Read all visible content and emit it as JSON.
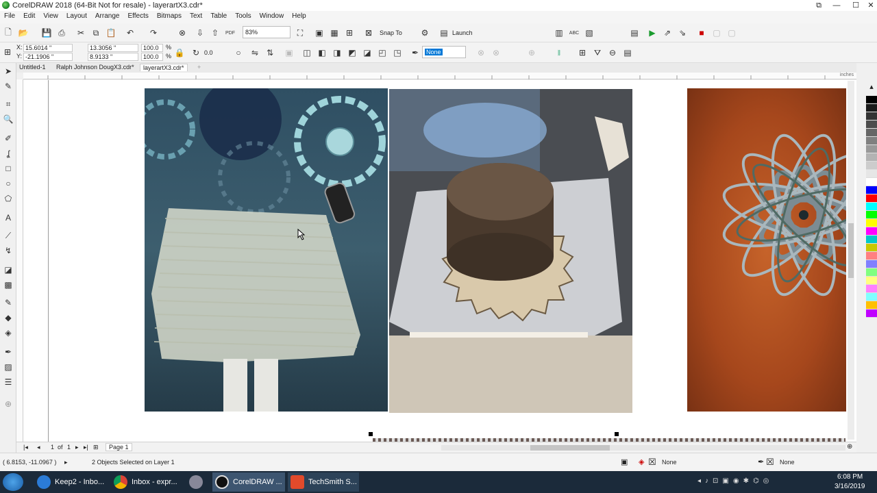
{
  "window": {
    "title": "CorelDRAW 2018 (64-Bit Not for resale) - layerartX3.cdr*",
    "controls": [
      "⧉",
      "—",
      "☐",
      "✕"
    ]
  },
  "menu": [
    "File",
    "Edit",
    "View",
    "Layout",
    "Arrange",
    "Effects",
    "Bitmaps",
    "Text",
    "Table",
    "Tools",
    "Window",
    "Help"
  ],
  "toolbar": {
    "zoom": "83%",
    "snap_to": "Snap To",
    "launch": "Launch"
  },
  "properties": {
    "x": "15.6014 \"",
    "y": "-21.1906 \"",
    "width": "13.3056 \"",
    "height": "8.9133 \"",
    "scale_x": "100.0",
    "scale_y": "100.0",
    "pct": "%",
    "rotation": "0.0",
    "outline": "None"
  },
  "doc_tabs": [
    "Untitled-1",
    "Ralph Johnson DougX3.cdr*",
    "layerartX3.cdr*"
  ],
  "ruler_unit": "inches",
  "page_nav": {
    "current": "1",
    "of": "of",
    "total": "1",
    "page_tab": "Page 1"
  },
  "status": {
    "coords": "( 6.8153, -11.0967 )",
    "selection": "2 Objects Selected on Layer 1",
    "fill": "None",
    "outline": "None"
  },
  "taskbar": {
    "items": [
      "Keep2 - Inbo...",
      "Inbox - expr...",
      "",
      "CorelDRAW ...",
      "TechSmith S..."
    ],
    "time": "6:08 PM",
    "date": "3/16/2019"
  },
  "colors": {
    "palette": [
      "#000000",
      "#1a1a1a",
      "#333333",
      "#4d4d4d",
      "#666666",
      "#808080",
      "#999999",
      "#b3b3b3",
      "#cccccc",
      "#e6e6e6",
      "#ffffff",
      "#0000ff",
      "#ff0000",
      "#00ffff",
      "#00ff00",
      "#ffff00",
      "#ff00ff",
      "#00c8c8",
      "#c8c800",
      "#ff8080",
      "#8080ff",
      "#80ff80",
      "#ffff80",
      "#ff80ff",
      "#80ffff",
      "#ffc000",
      "#c000ff"
    ],
    "accent": "#0078d7"
  }
}
